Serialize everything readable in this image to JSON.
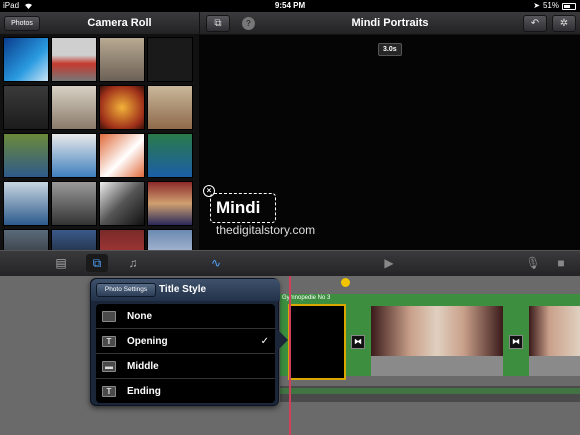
{
  "status_bar": {
    "carrier": "iPad",
    "time": "9:54 PM",
    "battery": "51%"
  },
  "left_nav": {
    "photos_button": "Photos",
    "title": "Camera Roll"
  },
  "right_nav": {
    "title": "Mindi Portraits"
  },
  "viewer": {
    "duration": "3.0s",
    "title_text": "Mindi",
    "watermark": "thedigitalstory.com"
  },
  "timeline": {
    "clip_label": "Gymnopedie No 3"
  },
  "popover": {
    "settings_button": "Photo Settings",
    "title": "Title Style",
    "options": [
      {
        "label": "None",
        "checked": ""
      },
      {
        "label": "Opening",
        "checked": "✓"
      },
      {
        "label": "Middle",
        "checked": ""
      },
      {
        "label": "Ending",
        "checked": ""
      }
    ]
  },
  "colors": {
    "accent": "#4da3ff",
    "track": "#3d8f3f",
    "playhead": "#d0405a",
    "selection": "#d9a800"
  }
}
